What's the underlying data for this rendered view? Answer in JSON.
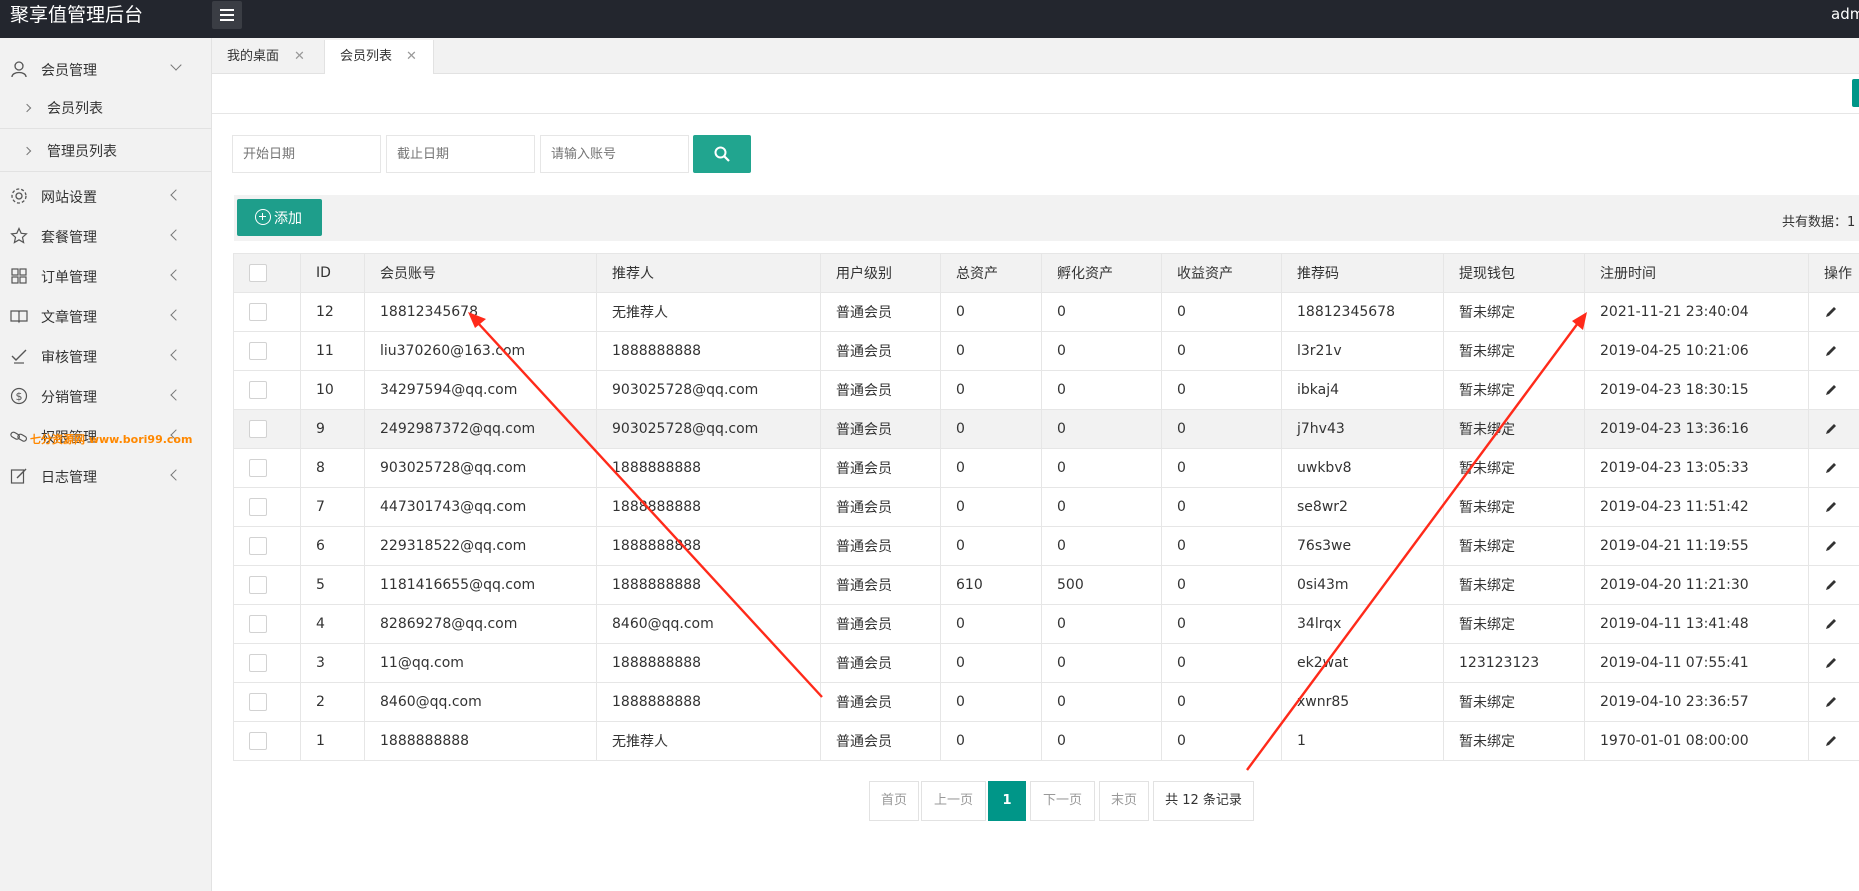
{
  "app": {
    "title": "聚享值管理后台",
    "user": "adm"
  },
  "sidebar": {
    "items": [
      {
        "label": "会员管理",
        "icon": "user-icon",
        "expanded": true
      },
      {
        "label": "网站设置",
        "icon": "gear-icon"
      },
      {
        "label": "套餐管理",
        "icon": "star-icon"
      },
      {
        "label": "订单管理",
        "icon": "grid-icon"
      },
      {
        "label": "文章管理",
        "icon": "book-icon"
      },
      {
        "label": "审核管理",
        "icon": "check-hand-icon"
      },
      {
        "label": "分销管理",
        "icon": "dollar-circle-icon"
      },
      {
        "label": "权限管理",
        "icon": "link-icon"
      },
      {
        "label": "日志管理",
        "icon": "edit-doc-icon"
      }
    ],
    "subitems": [
      "会员列表",
      "管理员列表"
    ],
    "watermark": "七分资源网 www.bori99.com"
  },
  "tabs": [
    {
      "label": "我的桌面",
      "active": false
    },
    {
      "label": "会员列表",
      "active": true
    }
  ],
  "search": {
    "start_placeholder": "开始日期",
    "end_placeholder": "截止日期",
    "account_placeholder": "请输入账号"
  },
  "toolbar": {
    "add_label": "添加",
    "total_label": "共有数据：1"
  },
  "table": {
    "columns": [
      "ID",
      "会员账号",
      "推荐人",
      "用户级别",
      "总资产",
      "孵化资产",
      "收益资产",
      "推荐码",
      "提现钱包",
      "注册时间",
      "操作"
    ],
    "rows": [
      [
        "12",
        "18812345678",
        "无推荐人",
        "普通会员",
        "0",
        "0",
        "0",
        "18812345678",
        "暂未绑定",
        "2021-11-21 23:40:04"
      ],
      [
        "11",
        "liu370260@163.com",
        "1888888888",
        "普通会员",
        "0",
        "0",
        "0",
        "l3r21v",
        "暂未绑定",
        "2019-04-25 10:21:06"
      ],
      [
        "10",
        "34297594@qq.com",
        "903025728@qq.com",
        "普通会员",
        "0",
        "0",
        "0",
        "ibkaj4",
        "暂未绑定",
        "2019-04-23 18:30:15"
      ],
      [
        "9",
        "2492987372@qq.com",
        "903025728@qq.com",
        "普通会员",
        "0",
        "0",
        "0",
        "j7hv43",
        "暂未绑定",
        "2019-04-23 13:36:16"
      ],
      [
        "8",
        "903025728@qq.com",
        "1888888888",
        "普通会员",
        "0",
        "0",
        "0",
        "uwkbv8",
        "暂未绑定",
        "2019-04-23 13:05:33"
      ],
      [
        "7",
        "447301743@qq.com",
        "1888888888",
        "普通会员",
        "0",
        "0",
        "0",
        "se8wr2",
        "暂未绑定",
        "2019-04-23 11:51:42"
      ],
      [
        "6",
        "229318522@qq.com",
        "1888888888",
        "普通会员",
        "0",
        "0",
        "0",
        "76s3we",
        "暂未绑定",
        "2019-04-21 11:19:55"
      ],
      [
        "5",
        "1181416655@qq.com",
        "1888888888",
        "普通会员",
        "610",
        "500",
        "0",
        "0si43m",
        "暂未绑定",
        "2019-04-20 11:21:30"
      ],
      [
        "4",
        "82869278@qq.com",
        "8460@qq.com",
        "普通会员",
        "0",
        "0",
        "0",
        "34lrqx",
        "暂未绑定",
        "2019-04-11 13:41:48"
      ],
      [
        "3",
        "11@qq.com",
        "1888888888",
        "普通会员",
        "0",
        "0",
        "0",
        "ek2wat",
        "123123123",
        "2019-04-11 07:55:41"
      ],
      [
        "2",
        "8460@qq.com",
        "1888888888",
        "普通会员",
        "0",
        "0",
        "0",
        "xwnr85",
        "暂未绑定",
        "2019-04-10 23:36:57"
      ],
      [
        "1",
        "1888888888",
        "无推荐人",
        "普通会员",
        "0",
        "0",
        "0",
        "1",
        "暂未绑定",
        "1970-01-01 08:00:00"
      ]
    ],
    "highlighted_row": 3
  },
  "pagination": {
    "first": "首页",
    "prev": "上一页",
    "current": "1",
    "next": "下一页",
    "last": "末页",
    "count": "共 12 条记录"
  },
  "colors": {
    "accent": "#009688",
    "header_bg": "#23262e",
    "annotation": "#ff2a1a"
  }
}
